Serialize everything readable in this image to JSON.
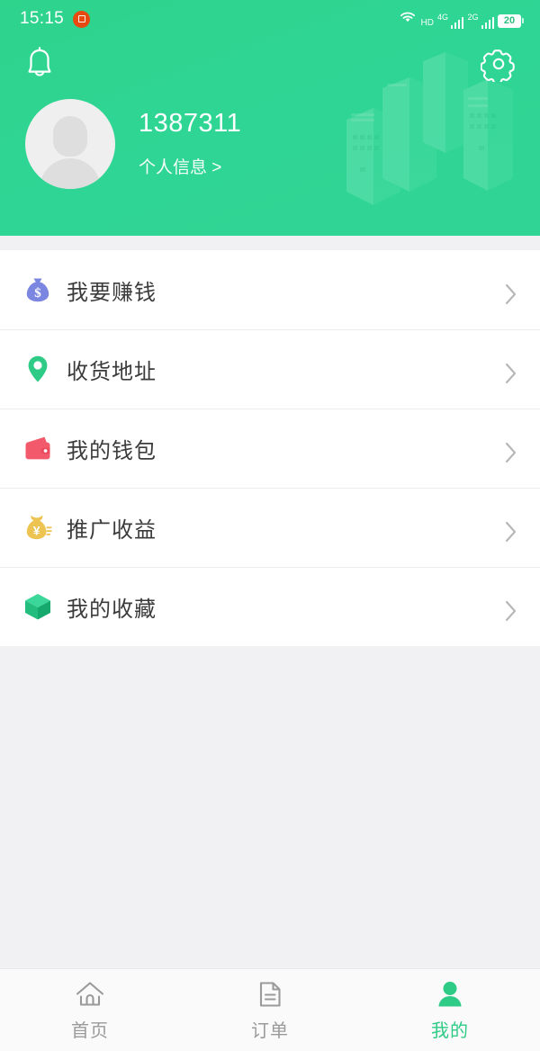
{
  "status_bar": {
    "time": "15:15",
    "recording_icon": "screen-record-icon",
    "wifi_icon": "wifi-icon",
    "hd_label": "HD",
    "sim1_label": "4G",
    "sim2_label": "2G",
    "battery_level": "20"
  },
  "header": {
    "notification_icon": "bell-icon",
    "settings_icon": "gear-icon",
    "avatar_icon": "avatar-placeholder-icon",
    "username": "1387311",
    "profile_link": "个人信息 >",
    "background_art": "city-skyline-illustration",
    "bg_color": "#2fd593"
  },
  "menu": {
    "items": [
      {
        "label": "我要赚钱",
        "icon": "money-bag-dollar-icon",
        "color": "#7b86e0",
        "chevron": "chevron-right-icon"
      },
      {
        "label": "收货地址",
        "icon": "location-pin-icon",
        "color": "#2ecb86",
        "chevron": "chevron-right-icon"
      },
      {
        "label": "我的钱包",
        "icon": "wallet-icon",
        "color": "#f2596a",
        "chevron": "chevron-right-icon"
      },
      {
        "label": "推广收益",
        "icon": "money-bag-yuan-icon",
        "color": "#edc352",
        "chevron": "chevron-right-icon"
      },
      {
        "label": "我的收藏",
        "icon": "box-cube-icon",
        "color": "#23bd7e",
        "chevron": "chevron-right-icon"
      }
    ]
  },
  "tabbar": {
    "active_color": "#2ecb86",
    "inactive_color": "#9a9a9a",
    "tabs": [
      {
        "label": "首页",
        "icon": "home-icon",
        "active": false
      },
      {
        "label": "订单",
        "icon": "document-icon",
        "active": false
      },
      {
        "label": "我的",
        "icon": "person-icon",
        "active": true
      }
    ]
  }
}
